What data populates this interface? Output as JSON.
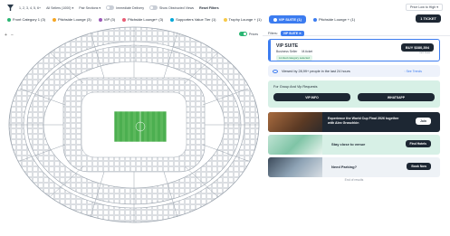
{
  "toolbar": {
    "quantity": "1, 2, 3, 4, 5, 6+",
    "sellers": "All Sellers (1000) ▾",
    "sections": "Pair Sections ▾",
    "immediate_delivery": "Immediate Delivery",
    "hide_obstructed": "Show Obstructed Views",
    "reset": "Reset Filters",
    "sort": "Price Low to High ▾"
  },
  "categories": [
    {
      "label": "Front Category 1 (3)",
      "color": "#2bb673"
    },
    {
      "label": "Pitchside Lounge (3)",
      "color": "#f5a623"
    },
    {
      "label": "VIP (3)",
      "color": "#9b59b6"
    },
    {
      "label": "Pitchside Lounge+ (3)",
      "color": "#e85d75"
    },
    {
      "label": "Supporters Value Tier (1)",
      "color": "#00a7d8"
    },
    {
      "label": "Trophy Lounge + (1)",
      "color": "#f7c948"
    },
    {
      "label": "VIP SUITE (1)",
      "color": "#ffffff",
      "active": true
    },
    {
      "label": "Pitchside Lounge + (1)",
      "color": "#3c7cf0"
    }
  ],
  "tickets_button": "1 TICKET",
  "map": {
    "prices_label": "Prices",
    "zoom_in": "+",
    "zoom_out": "−"
  },
  "panel": {
    "filters_label": "Filters:",
    "filter_chip": "VIP SUITE ✕",
    "listing": {
      "title": "VIP SUITE",
      "seller": "Business Seller",
      "ticket_type": "M-ticket",
      "tag": "Limited category selected",
      "buy_label": "BUY $380,394",
      "sub_price": "incl. fees"
    },
    "viewed_text": "Viewed by 28,99+ people in the last 24 hours",
    "trends_link": "◦ See Trends",
    "group": {
      "title": "For Group And Vip Requests",
      "vip_info": "VIP INFO",
      "whatsapp": "WHATSAPP"
    },
    "promos": [
      {
        "text": "Experience the World Cup Final 2026 together with Alex Groschkin",
        "button": "Join"
      },
      {
        "text": "Stay close to venue",
        "button": "Find Hotels"
      },
      {
        "text": "Need Parking?",
        "button": "Book Now"
      }
    ],
    "end_text": "End of results"
  },
  "colors": {
    "accent": "#3c7cf0",
    "dark": "#1d2733",
    "pitch": "#4caf50",
    "mint": "#d7f0e6"
  }
}
